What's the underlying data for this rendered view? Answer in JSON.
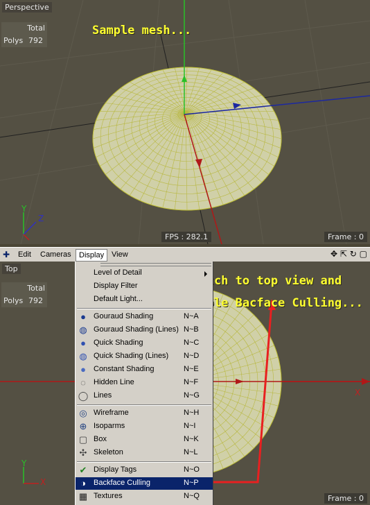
{
  "colors": {
    "mesh_fill": "#d0d0a8",
    "mesh_wire": "#c8c828",
    "annotation": "#ffff30",
    "arrow": "#e82020",
    "menu_highlight": "#0a246a"
  },
  "top_viewport": {
    "label": "Perspective",
    "stats": {
      "header": "Total",
      "key": "Polys",
      "value": "792"
    },
    "note": "Sample mesh...",
    "fps": "FPS : 282.1",
    "frame": "Frame : 0",
    "axis_labels": {
      "y": "Y",
      "z": "Z"
    }
  },
  "menubar": {
    "items": [
      "Edit",
      "Cameras",
      "Display",
      "View"
    ],
    "active": "Display",
    "right_icons": [
      "move-view-icon",
      "zoom-view-icon",
      "rotate-view-icon",
      "maximize-view-icon"
    ]
  },
  "bottom_viewport": {
    "label": "Top",
    "stats": {
      "header": "Total",
      "key": "Polys",
      "value": "792"
    },
    "note_lines": [
      "Switch to top view and",
      "enable Bacface Culling..."
    ],
    "frame": "Frame : 0",
    "axis_labels": {
      "y": "Y",
      "x": "X",
      "x_far": "X"
    }
  },
  "display_menu": {
    "groups": [
      [
        {
          "label": "Level of Detail",
          "shortcut": "",
          "icon": "none",
          "submenu": true
        },
        {
          "label": "Display Filter",
          "shortcut": "",
          "icon": "none"
        },
        {
          "label": "Default Light...",
          "shortcut": "",
          "icon": "none"
        }
      ],
      [
        {
          "label": "Gouraud Shading",
          "shortcut": "N~A",
          "icon": "sphere-solid-icon"
        },
        {
          "label": "Gouraud Shading (Lines)",
          "shortcut": "N~B",
          "icon": "sphere-lines-icon"
        },
        {
          "label": "Quick Shading",
          "shortcut": "N~C",
          "icon": "sphere-quick-icon"
        },
        {
          "label": "Quick Shading (Lines)",
          "shortcut": "N~D",
          "icon": "sphere-quick-lines-icon"
        },
        {
          "label": "Constant Shading",
          "shortcut": "N~E",
          "icon": "sphere-constant-icon"
        },
        {
          "label": "Hidden Line",
          "shortcut": "N~F",
          "icon": "hidden-line-icon"
        },
        {
          "label": "Lines",
          "shortcut": "N~G",
          "icon": "lines-icon"
        }
      ],
      [
        {
          "label": "Wireframe",
          "shortcut": "N~H",
          "icon": "wireframe-icon"
        },
        {
          "label": "Isoparms",
          "shortcut": "N~I",
          "icon": "isoparms-icon"
        },
        {
          "label": "Box",
          "shortcut": "N~K",
          "icon": "box-icon"
        },
        {
          "label": "Skeleton",
          "shortcut": "N~L",
          "icon": "skeleton-icon"
        }
      ],
      [
        {
          "label": "Display Tags",
          "shortcut": "N~O",
          "icon": "display-tags-icon"
        },
        {
          "label": "Backface Culling",
          "shortcut": "N~P",
          "icon": "backface-culling-icon",
          "selected": true
        },
        {
          "label": "Textures",
          "shortcut": "N~Q",
          "icon": "textures-icon"
        }
      ]
    ]
  }
}
